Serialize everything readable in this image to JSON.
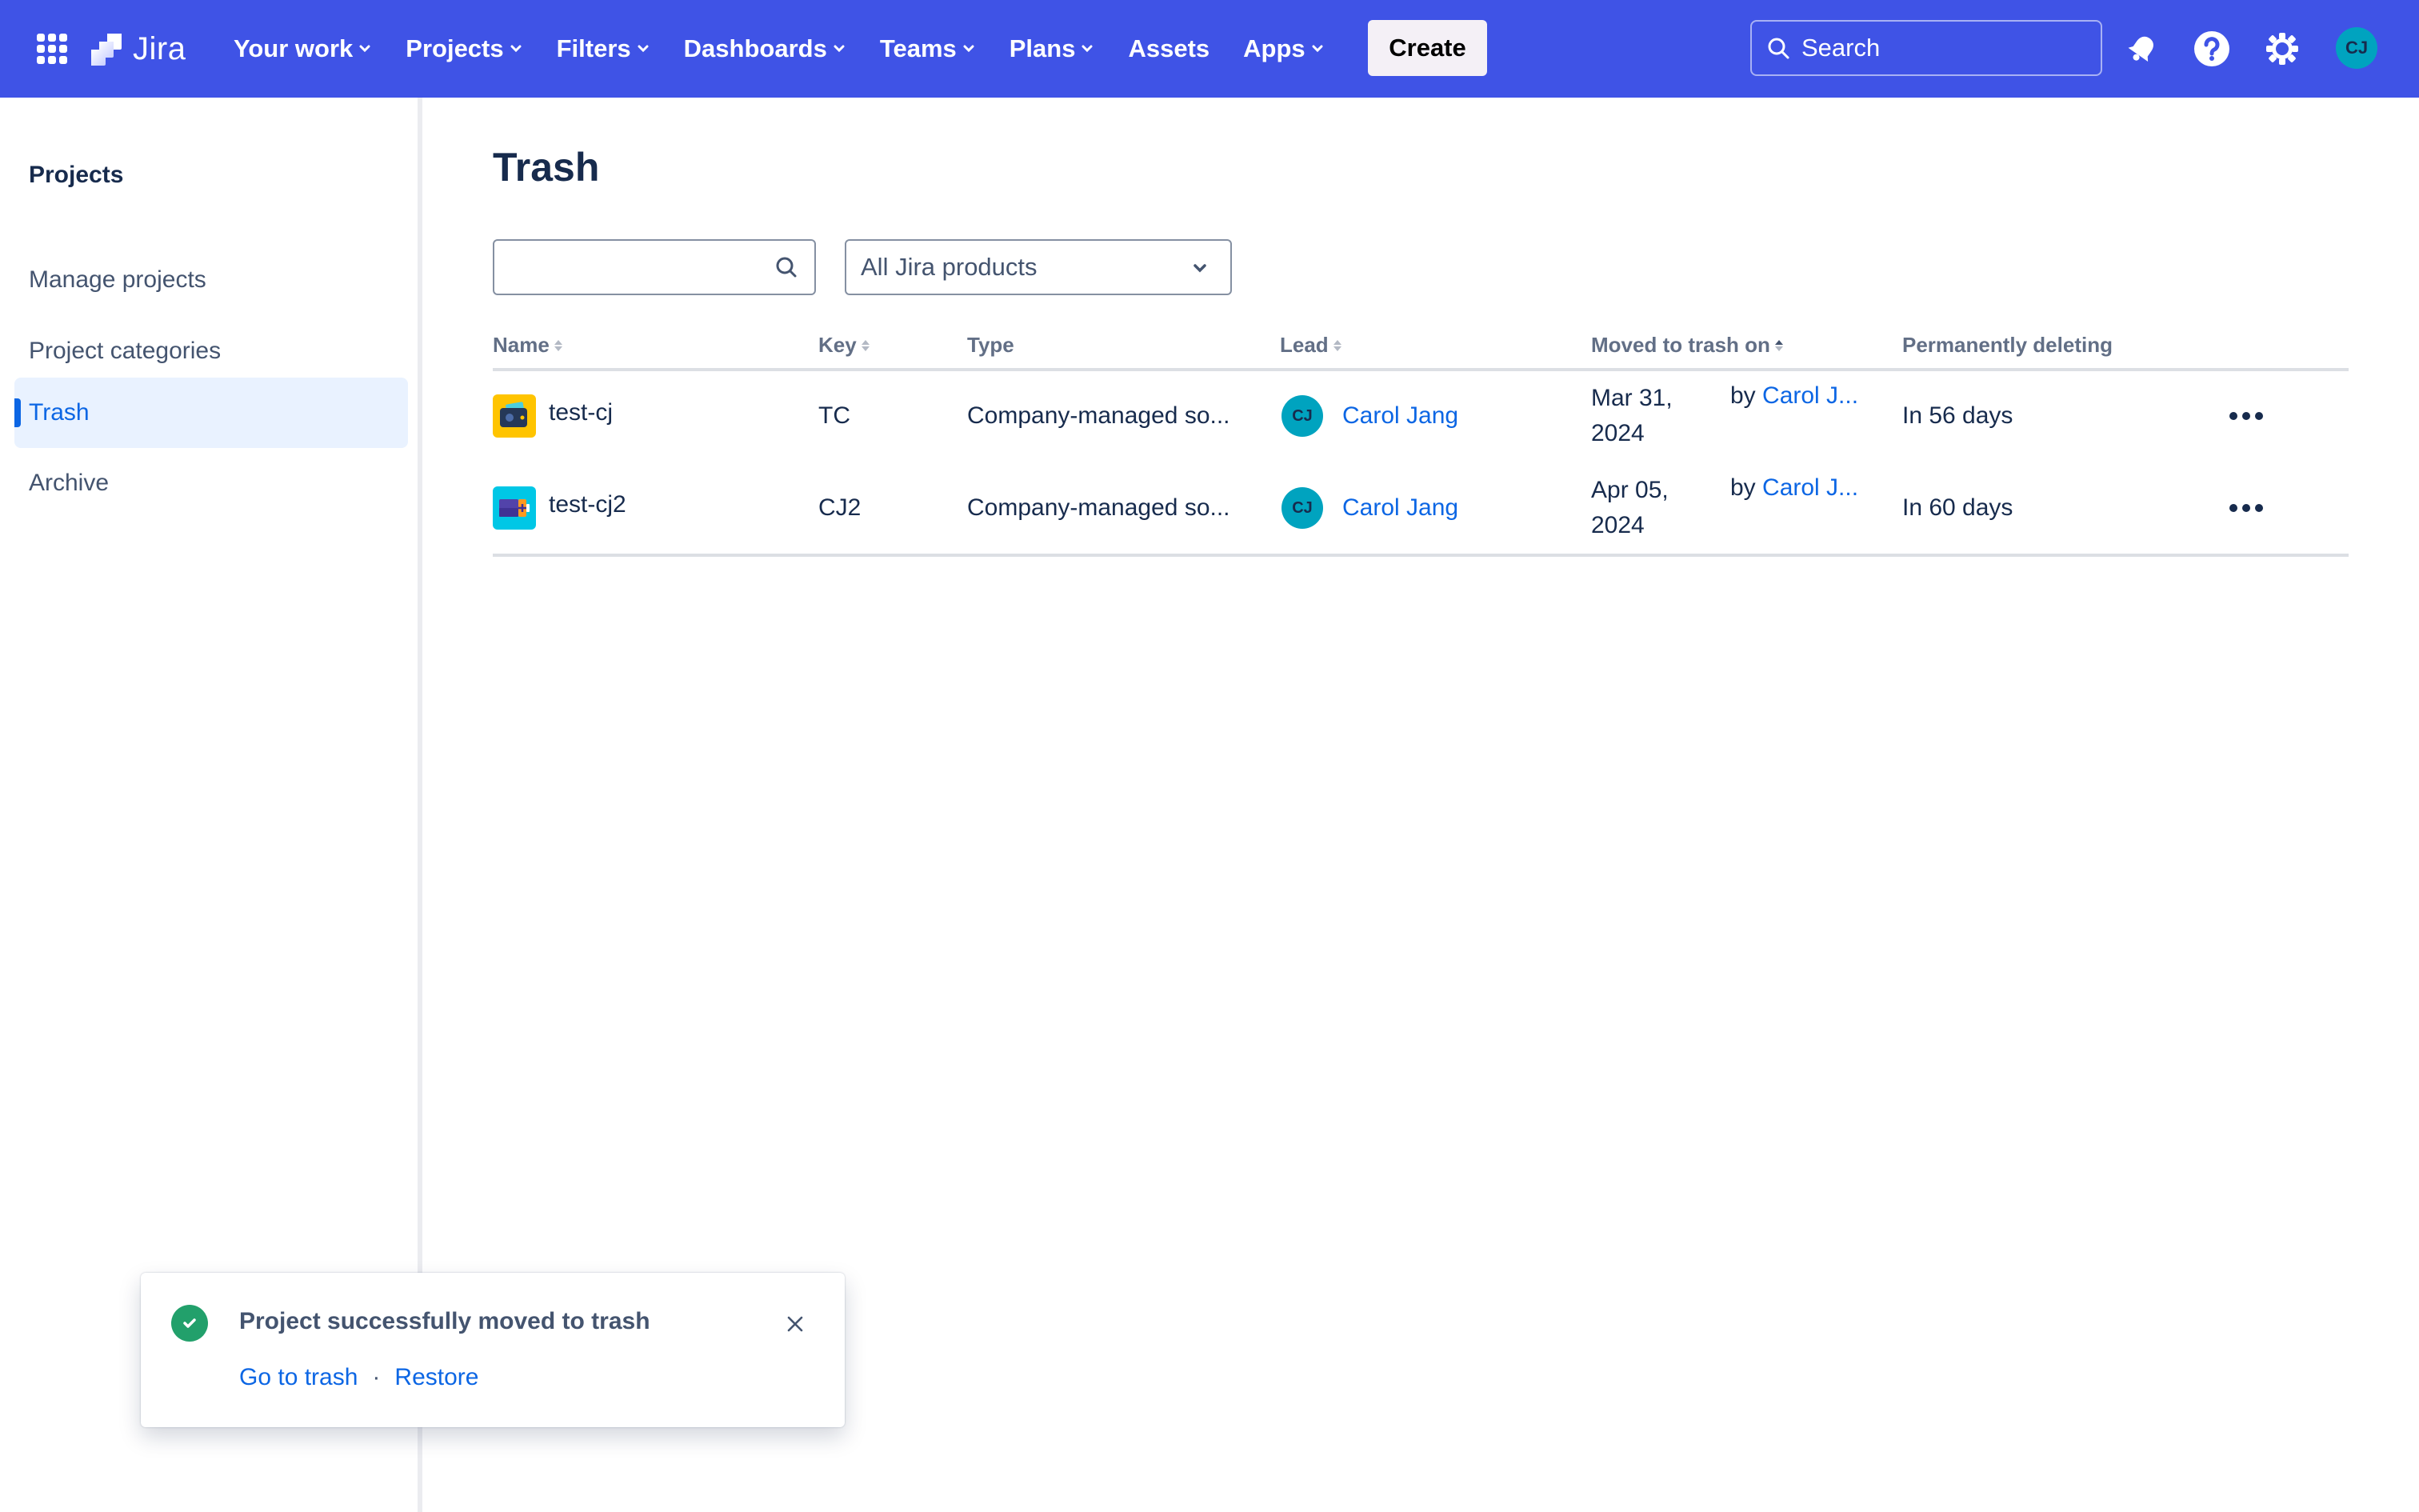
{
  "topnav": {
    "product_name": "Jira",
    "items": [
      {
        "label": "Your work",
        "has_dropdown": true
      },
      {
        "label": "Projects",
        "has_dropdown": true
      },
      {
        "label": "Filters",
        "has_dropdown": true
      },
      {
        "label": "Dashboards",
        "has_dropdown": true
      },
      {
        "label": "Teams",
        "has_dropdown": true
      },
      {
        "label": "Plans",
        "has_dropdown": true
      },
      {
        "label": "Assets",
        "has_dropdown": false
      },
      {
        "label": "Apps",
        "has_dropdown": true
      }
    ],
    "create_label": "Create",
    "search_placeholder": "Search",
    "icons": [
      "apps-grid-icon",
      "jira-logo-icon",
      "notifications-bell-icon",
      "help-icon",
      "settings-gear-icon"
    ],
    "user_initials": "CJ",
    "brand_color": "#3F53E6"
  },
  "sidebar": {
    "title": "Projects",
    "items": [
      {
        "label": "Manage projects",
        "selected": false
      },
      {
        "label": "Project categories",
        "selected": false
      },
      {
        "label": "Trash",
        "selected": true
      },
      {
        "label": "Archive",
        "selected": false
      }
    ]
  },
  "main": {
    "title": "Trash",
    "search": {
      "value": "",
      "placeholder": ""
    },
    "product_filter": {
      "selected": "All Jira products"
    },
    "table": {
      "columns": [
        {
          "label": "Name",
          "sortable": true,
          "sort": "none"
        },
        {
          "label": "Key",
          "sortable": true,
          "sort": "none"
        },
        {
          "label": "Type",
          "sortable": false
        },
        {
          "label": "Lead",
          "sortable": true,
          "sort": "none"
        },
        {
          "label": "Moved to trash on",
          "sortable": true,
          "sort": "asc"
        },
        {
          "label": "Permanently deleting",
          "sortable": false
        }
      ],
      "rows": [
        {
          "name": "test-cj",
          "icon": "wallet-project-icon",
          "key": "TC",
          "type": "Company-managed so...",
          "lead_initials": "CJ",
          "lead": "Carol Jang",
          "moved_date_line1": "Mar 31,",
          "moved_date_line2": "2024",
          "moved_by_prefix": "by",
          "moved_by": "Carol J...",
          "deleting": "In 56 days"
        },
        {
          "name": "test-cj2",
          "icon": "battery-project-icon",
          "key": "CJ2",
          "type": "Company-managed so...",
          "lead_initials": "CJ",
          "lead": "Carol Jang",
          "moved_date_line1": "Apr 05,",
          "moved_date_line2": "2024",
          "moved_by_prefix": "by",
          "moved_by": "Carol J...",
          "deleting": "In 60 days"
        }
      ]
    }
  },
  "toast": {
    "message": "Project successfully moved to trash",
    "actions": [
      "Go to trash",
      "Restore"
    ],
    "separator": "·",
    "status": "success",
    "status_color": "#22A06B"
  }
}
